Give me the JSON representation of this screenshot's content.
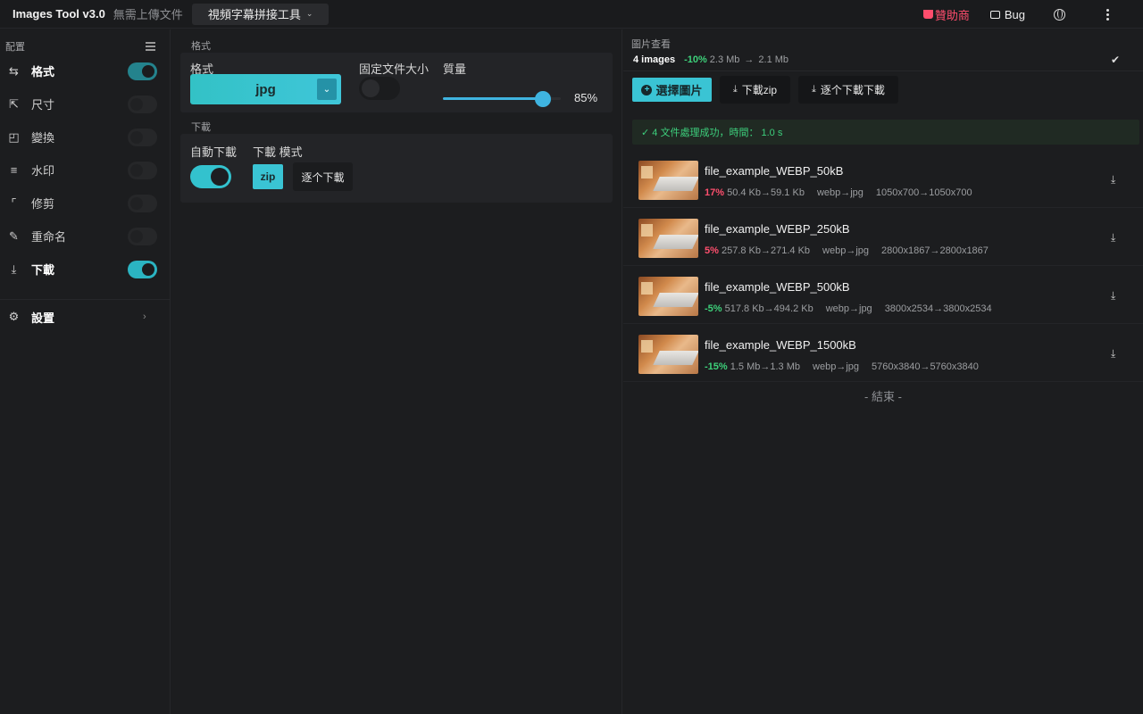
{
  "header": {
    "title": "Images Tool v3.0",
    "subtitle": "無需上傳文件",
    "tool_select": "視頻字幕拼接工具",
    "sponsor": "贊助商",
    "bug": "Bug"
  },
  "sidebar": {
    "heading": "配置",
    "items": [
      {
        "label": "格式",
        "icon": "swap-icon",
        "enabled": true,
        "active": true
      },
      {
        "label": "尺寸",
        "icon": "crop-resize-icon",
        "enabled": false,
        "active": false
      },
      {
        "label": "變換",
        "icon": "transform-icon",
        "enabled": false,
        "active": false
      },
      {
        "label": "水印",
        "icon": "watermark-icon",
        "enabled": false,
        "active": false
      },
      {
        "label": "修剪",
        "icon": "crop-icon",
        "enabled": false,
        "active": false
      },
      {
        "label": "重命名",
        "icon": "rename-icon",
        "enabled": false,
        "active": false
      },
      {
        "label": "下載",
        "icon": "download-icon",
        "enabled": true,
        "active": true
      }
    ],
    "settings": "設置"
  },
  "format_section": {
    "heading": "格式",
    "format_label": "格式",
    "format_value": "jpg",
    "fixed_size_label": "固定文件大小",
    "fixed_size_enabled": false,
    "quality_label": "質量",
    "quality_value": "85%",
    "quality_fraction": 0.85
  },
  "download_section": {
    "heading": "下載",
    "auto_label": "自動下載",
    "auto_enabled": true,
    "mode_label": "下載 模式",
    "mode_zip": "zip",
    "mode_seq": "逐个下載"
  },
  "preview": {
    "heading": "圖片查看",
    "count": "4 images",
    "pct": "-10%",
    "size_from": "2.3 Mb",
    "size_to": "2.1 Mb",
    "choose_btn": "選擇圖片",
    "zip_btn": "下載zip",
    "seq_btn": "逐个下載下載",
    "success": "✓ 4 文件處理成功，時間： 1.0 s",
    "end": "- 結束 -",
    "files": [
      {
        "name": "file_example_WEBP_50kB",
        "pct": "17%",
        "dir": "up",
        "sizes": "50.4 Kb→59.1 Kb",
        "conv": "webp→jpg",
        "dims": "1050x700→1050x700"
      },
      {
        "name": "file_example_WEBP_250kB",
        "pct": "5%",
        "dir": "up",
        "sizes": "257.8 Kb→271.4 Kb",
        "conv": "webp→jpg",
        "dims": "2800x1867→2800x1867"
      },
      {
        "name": "file_example_WEBP_500kB",
        "pct": "-5%",
        "dir": "down",
        "sizes": "517.8 Kb→494.2 Kb",
        "conv": "webp→jpg",
        "dims": "3800x2534→3800x2534"
      },
      {
        "name": "file_example_WEBP_1500kB",
        "pct": "-15%",
        "dir": "down",
        "sizes": "1.5 Mb→1.3 Mb",
        "conv": "webp→jpg",
        "dims": "5760x3840→5760x3840"
      }
    ]
  },
  "colors": {
    "accent": "#3ac4d4",
    "increase": "#ff4f6e",
    "decrease": "#3dd17a",
    "sponsor": "#ff4d6d"
  }
}
